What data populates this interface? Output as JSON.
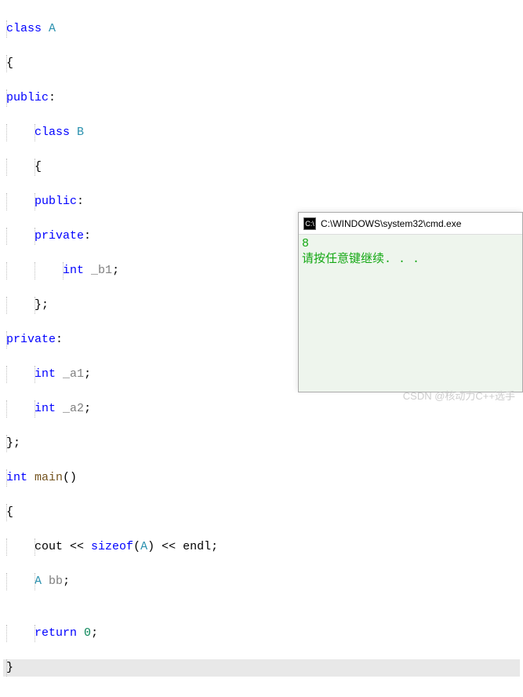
{
  "code": {
    "l1": {
      "kw1": "class",
      "cls1": "A"
    },
    "l2": "{",
    "l3": {
      "kw1": "public",
      "col": ":"
    },
    "l4": {
      "kw1": "class",
      "cls1": "B"
    },
    "l5": "{",
    "l6": {
      "kw1": "public",
      "col": ":"
    },
    "l7": {
      "kw1": "private",
      "col": ":"
    },
    "l8": {
      "kw1": "int",
      "var1": "_b1",
      "semi": ";"
    },
    "l9": "};",
    "l10": {
      "kw1": "private",
      "col": ":"
    },
    "l11": {
      "kw1": "int",
      "var1": "_a1",
      "semi": ";"
    },
    "l12": {
      "kw1": "int",
      "var1": "_a2",
      "semi": ";"
    },
    "l13": "};",
    "l14": {
      "kw1": "int",
      "func1": "main",
      "parens": "()"
    },
    "l15": "{",
    "l16": {
      "ident1": "cout",
      "op1": " << ",
      "kw1": "sizeof",
      "paren_open": "(",
      "cls1": "A",
      "paren_close": ")",
      "op2": " << ",
      "ident2": "endl",
      "semi": ";"
    },
    "l17": {
      "cls1": "A",
      "var1": "bb",
      "semi": ";"
    },
    "l18": "",
    "l19": {
      "kw1": "return",
      "num1": "0",
      "semi": ";"
    },
    "l20": "}"
  },
  "console": {
    "title": "C:\\WINDOWS\\system32\\cmd.exe",
    "icon_text": "C:\\",
    "output_line1": "8",
    "output_line2": "请按任意键继续. . ."
  },
  "watermark": "CSDN @核动力C++选手"
}
